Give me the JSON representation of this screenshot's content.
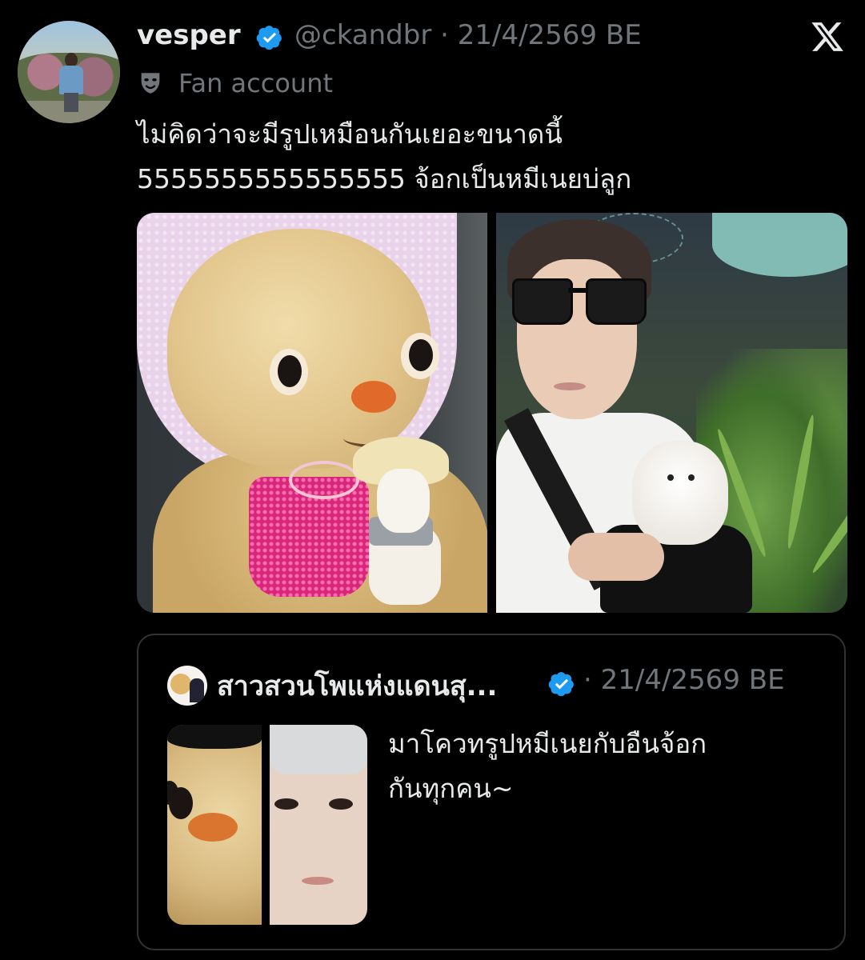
{
  "author": {
    "name": "vesper",
    "handle_and_date": "@ckandbr · 21/4/2569 BE",
    "label": "Fan account",
    "verified_icon": "verified-badge-icon",
    "label_icon": "masks-icon"
  },
  "post": {
    "line1": "ไม่คิดว่าจะมีรูปเหมือนกันเยอะขนาดนี้",
    "line2": "5555555555555555 จ้อกเป็นหมีเนยบ่ลูก"
  },
  "header": {
    "close_icon": "x-logo-icon"
  },
  "media": {
    "images": [
      {
        "name": "teddy-bear-photo"
      },
      {
        "name": "man-with-alpaca-photo"
      }
    ]
  },
  "quoted": {
    "name": "สาวสวนโพแห่งแดนสุ...",
    "date": "· 21/4/2569 BE",
    "text_line1": "มาโควทรูปหมีเนยกับอืนจ้อก",
    "text_line2": "กันทุกคน~"
  },
  "colors": {
    "background": "#000000",
    "text": "#e7e9ea",
    "muted": "#71767b",
    "verified": "#1d9bf0",
    "border": "#2f3336"
  }
}
